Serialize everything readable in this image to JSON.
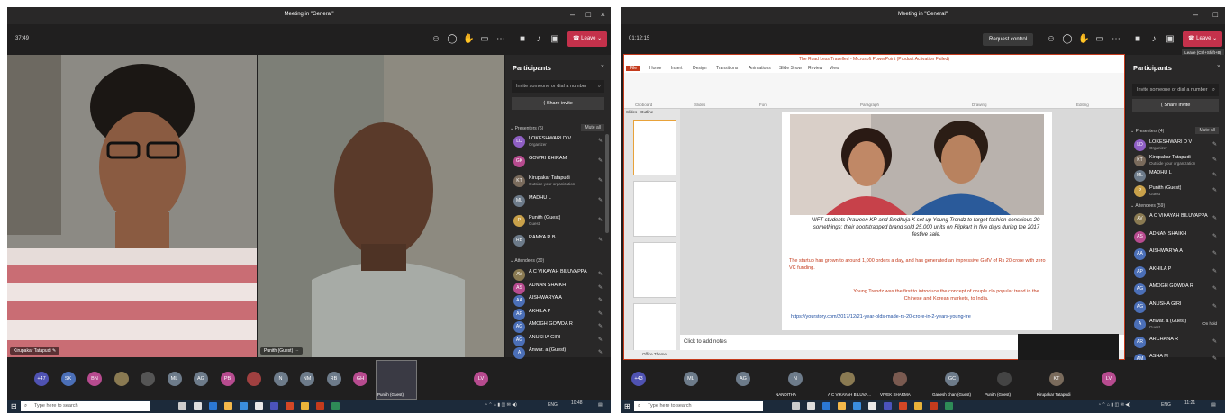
{
  "left": {
    "window_title": "Meeting in \"General\"",
    "timer": "37:49",
    "leave_label": "Leave",
    "videos": [
      {
        "name": "Kirupakar Tatapudi"
      },
      {
        "name": "Punith (Guest)"
      }
    ],
    "participants_panel": {
      "title": "Participants",
      "invite_placeholder": "Invite someone or dial a number",
      "share_invite": "Share invite",
      "presenters_header": "Presenters (6)",
      "mute_all": "Mute all",
      "presenters": [
        {
          "name": "LOKESHWARI D V",
          "sub": "Organizer",
          "initials": "LD",
          "color": "#8f5fc4"
        },
        {
          "name": "GOWRI KHIRAM",
          "sub": "",
          "initials": "GK",
          "color": "#b74b8f"
        },
        {
          "name": "Kirupakar Tatapudi",
          "sub": "Outside your organization",
          "initials": "KT",
          "color": "#7a6b5c"
        },
        {
          "name": "MADHU L",
          "sub": "",
          "initials": "ML",
          "color": "#6d7b8a"
        },
        {
          "name": "Punith (Guest)",
          "sub": "Guest",
          "initials": "P",
          "color": "#c9a14a"
        },
        {
          "name": "RAMYA R B",
          "sub": "",
          "initials": "RB",
          "color": "#6d7b8a"
        }
      ],
      "attendees_header": "Attendees (30)",
      "attendees": [
        {
          "name": "A C VIKAYAH BILUVAPPA",
          "initials": "AV",
          "color": "#8a7a52"
        },
        {
          "name": "ADNAN SHAIKH",
          "initials": "AS",
          "color": "#b74b8f"
        },
        {
          "name": "AISHWARYA A",
          "initials": "AA",
          "color": "#4b6fb7"
        },
        {
          "name": "AKHILA P",
          "initials": "AP",
          "color": "#4b6fb7"
        },
        {
          "name": "AMOGH GOWDA R",
          "initials": "AG",
          "color": "#4b6fb7"
        },
        {
          "name": "ANUSHA GIRI",
          "initials": "AG",
          "color": "#4b6fb7"
        },
        {
          "name": "Anwar. a (Guest)",
          "initials": "A",
          "color": "#4b6fb7"
        }
      ]
    },
    "bubbles": [
      {
        "t": "+47",
        "color": "#4f52b2"
      },
      {
        "t": "SK",
        "color": "#4b6fb7"
      },
      {
        "t": "BN",
        "color": "#b74b8f"
      },
      {
        "t": "",
        "color": "#8a7a52"
      },
      {
        "t": "",
        "color": "#555555"
      },
      {
        "t": "ML",
        "color": "#6d7b8a"
      },
      {
        "t": "AG",
        "color": "#6d7b8a"
      },
      {
        "t": "PB",
        "color": "#b74b8f"
      },
      {
        "t": "",
        "color": "#a04040"
      },
      {
        "t": "N",
        "color": "#6d7b8a"
      },
      {
        "t": "NM",
        "color": "#6d7b8a"
      },
      {
        "t": "RB",
        "color": "#6d7b8a"
      },
      {
        "t": "GH",
        "color": "#b74b8f"
      },
      {
        "t": "P",
        "color": "#c9a14a"
      },
      {
        "t": "LV",
        "color": "#b74b8f"
      }
    ],
    "punith_label": "Punith (Guest)",
    "taskbar": {
      "search_placeholder": "Type here to search",
      "time": "10:48",
      "lang": "ENG"
    }
  },
  "right": {
    "window_title": "Meeting in \"General\"",
    "timer": "01:12:15",
    "request_control": "Request control",
    "leave_label": "Leave",
    "leave_tooltip": "Leave (Ctrl+Shift+B)",
    "ppt": {
      "title": "The Road Less Travelled  -  Microsoft PowerPoint (Product Activation Failed)",
      "tabs": [
        "File",
        "Home",
        "Insert",
        "Design",
        "Transitions",
        "Animations",
        "Slide Show",
        "Review",
        "View"
      ],
      "groups": [
        "Clipboard",
        "Slides",
        "Font",
        "Paragraph",
        "Drawing",
        "Editing"
      ],
      "panel_tabs": [
        "Slides",
        "Outline"
      ],
      "caption": "NIFT students Praween KR and Sindhuja K set up Young Trendz to target fashion-conscious 20-somethings; their bootstrapped brand sold 25,000 units on Flipkart in five days during the 2017 festive sale.",
      "red1": "The startup has grown to around 1,000 orders a day, and has generated an impressive GMV of Rs 20 crore with zero VC funding.",
      "red2": "Young Trendz was the first to introduce the concept of couple clo popular trend in the Chinese and Korean markets, to India.",
      "url": "https://yourstory.com/2017/12/21-year-olds-made-rs-20-crore-in-2-years-young-tre",
      "notes": "Click to add notes",
      "status": "Office Theme"
    },
    "participants_panel": {
      "title": "Participants",
      "invite_placeholder": "Invite someone or dial a number",
      "share_invite": "Share invite",
      "presenters_header": "Presenters (4)",
      "mute_all": "Mute all",
      "presenters": [
        {
          "name": "LOKESHWARI D V",
          "sub": "Organizer",
          "initials": "LD",
          "color": "#8f5fc4"
        },
        {
          "name": "Kirupakar Tatapudi",
          "sub": "Outside your organization",
          "initials": "KT",
          "color": "#7a6b5c"
        },
        {
          "name": "MADHU L",
          "sub": "",
          "initials": "ML",
          "color": "#6d7b8a"
        },
        {
          "name": "Punith (Guest)",
          "sub": "Guest",
          "initials": "P",
          "color": "#c9a14a"
        }
      ],
      "attendees_header": "Attendees (59)",
      "attendees": [
        {
          "name": "A C VIKAYAH BILUVAPPA",
          "initials": "AV",
          "color": "#8a7a52"
        },
        {
          "name": "ADNAN SHAIKH",
          "initials": "AS",
          "color": "#b74b8f"
        },
        {
          "name": "AISHWARYA A",
          "initials": "AA",
          "color": "#4b6fb7"
        },
        {
          "name": "AKHILA P",
          "initials": "AP",
          "color": "#4b6fb7"
        },
        {
          "name": "AMOGH GOWDA R",
          "initials": "AG",
          "color": "#4b6fb7"
        },
        {
          "name": "ANUSHA GIRI",
          "initials": "AG",
          "color": "#4b6fb7"
        },
        {
          "name": "Anwar. a (Guest)",
          "sub": "Guest",
          "extra": "On hold",
          "initials": "A",
          "color": "#4b6fb7"
        },
        {
          "name": "ARCHANA R",
          "initials": "AR",
          "color": "#4b6fb7"
        },
        {
          "name": "ASHA M",
          "initials": "AM",
          "color": "#4b6fb7"
        }
      ]
    },
    "bubbles": [
      {
        "t": "+43",
        "color": "#4f52b2",
        "label": ""
      },
      {
        "t": "ML",
        "color": "#6d7b8a",
        "label": ""
      },
      {
        "t": "AG",
        "color": "#6d7b8a",
        "label": ""
      },
      {
        "t": "N",
        "color": "#6d7b8a",
        "label": "NANDITHA"
      },
      {
        "t": "",
        "color": "#8a7a52",
        "label": "A C VIKAYAH BILUVA..."
      },
      {
        "t": "",
        "color": "#7a5a50",
        "label": "VIVEK SHARMA"
      },
      {
        "t": "GC",
        "color": "#6d7b8a",
        "label": "Ganesh chan (Guest)"
      },
      {
        "t": "",
        "color": "#444444",
        "label": "Punith (Guest)"
      },
      {
        "t": "KT",
        "color": "#7a6b5c",
        "label": "Kirupakar Tatapudi"
      },
      {
        "t": "LV",
        "color": "#b74b8f",
        "label": ""
      }
    ],
    "taskbar": {
      "search_placeholder": "Type here to search",
      "time": "11:21",
      "lang": "ENG"
    }
  }
}
